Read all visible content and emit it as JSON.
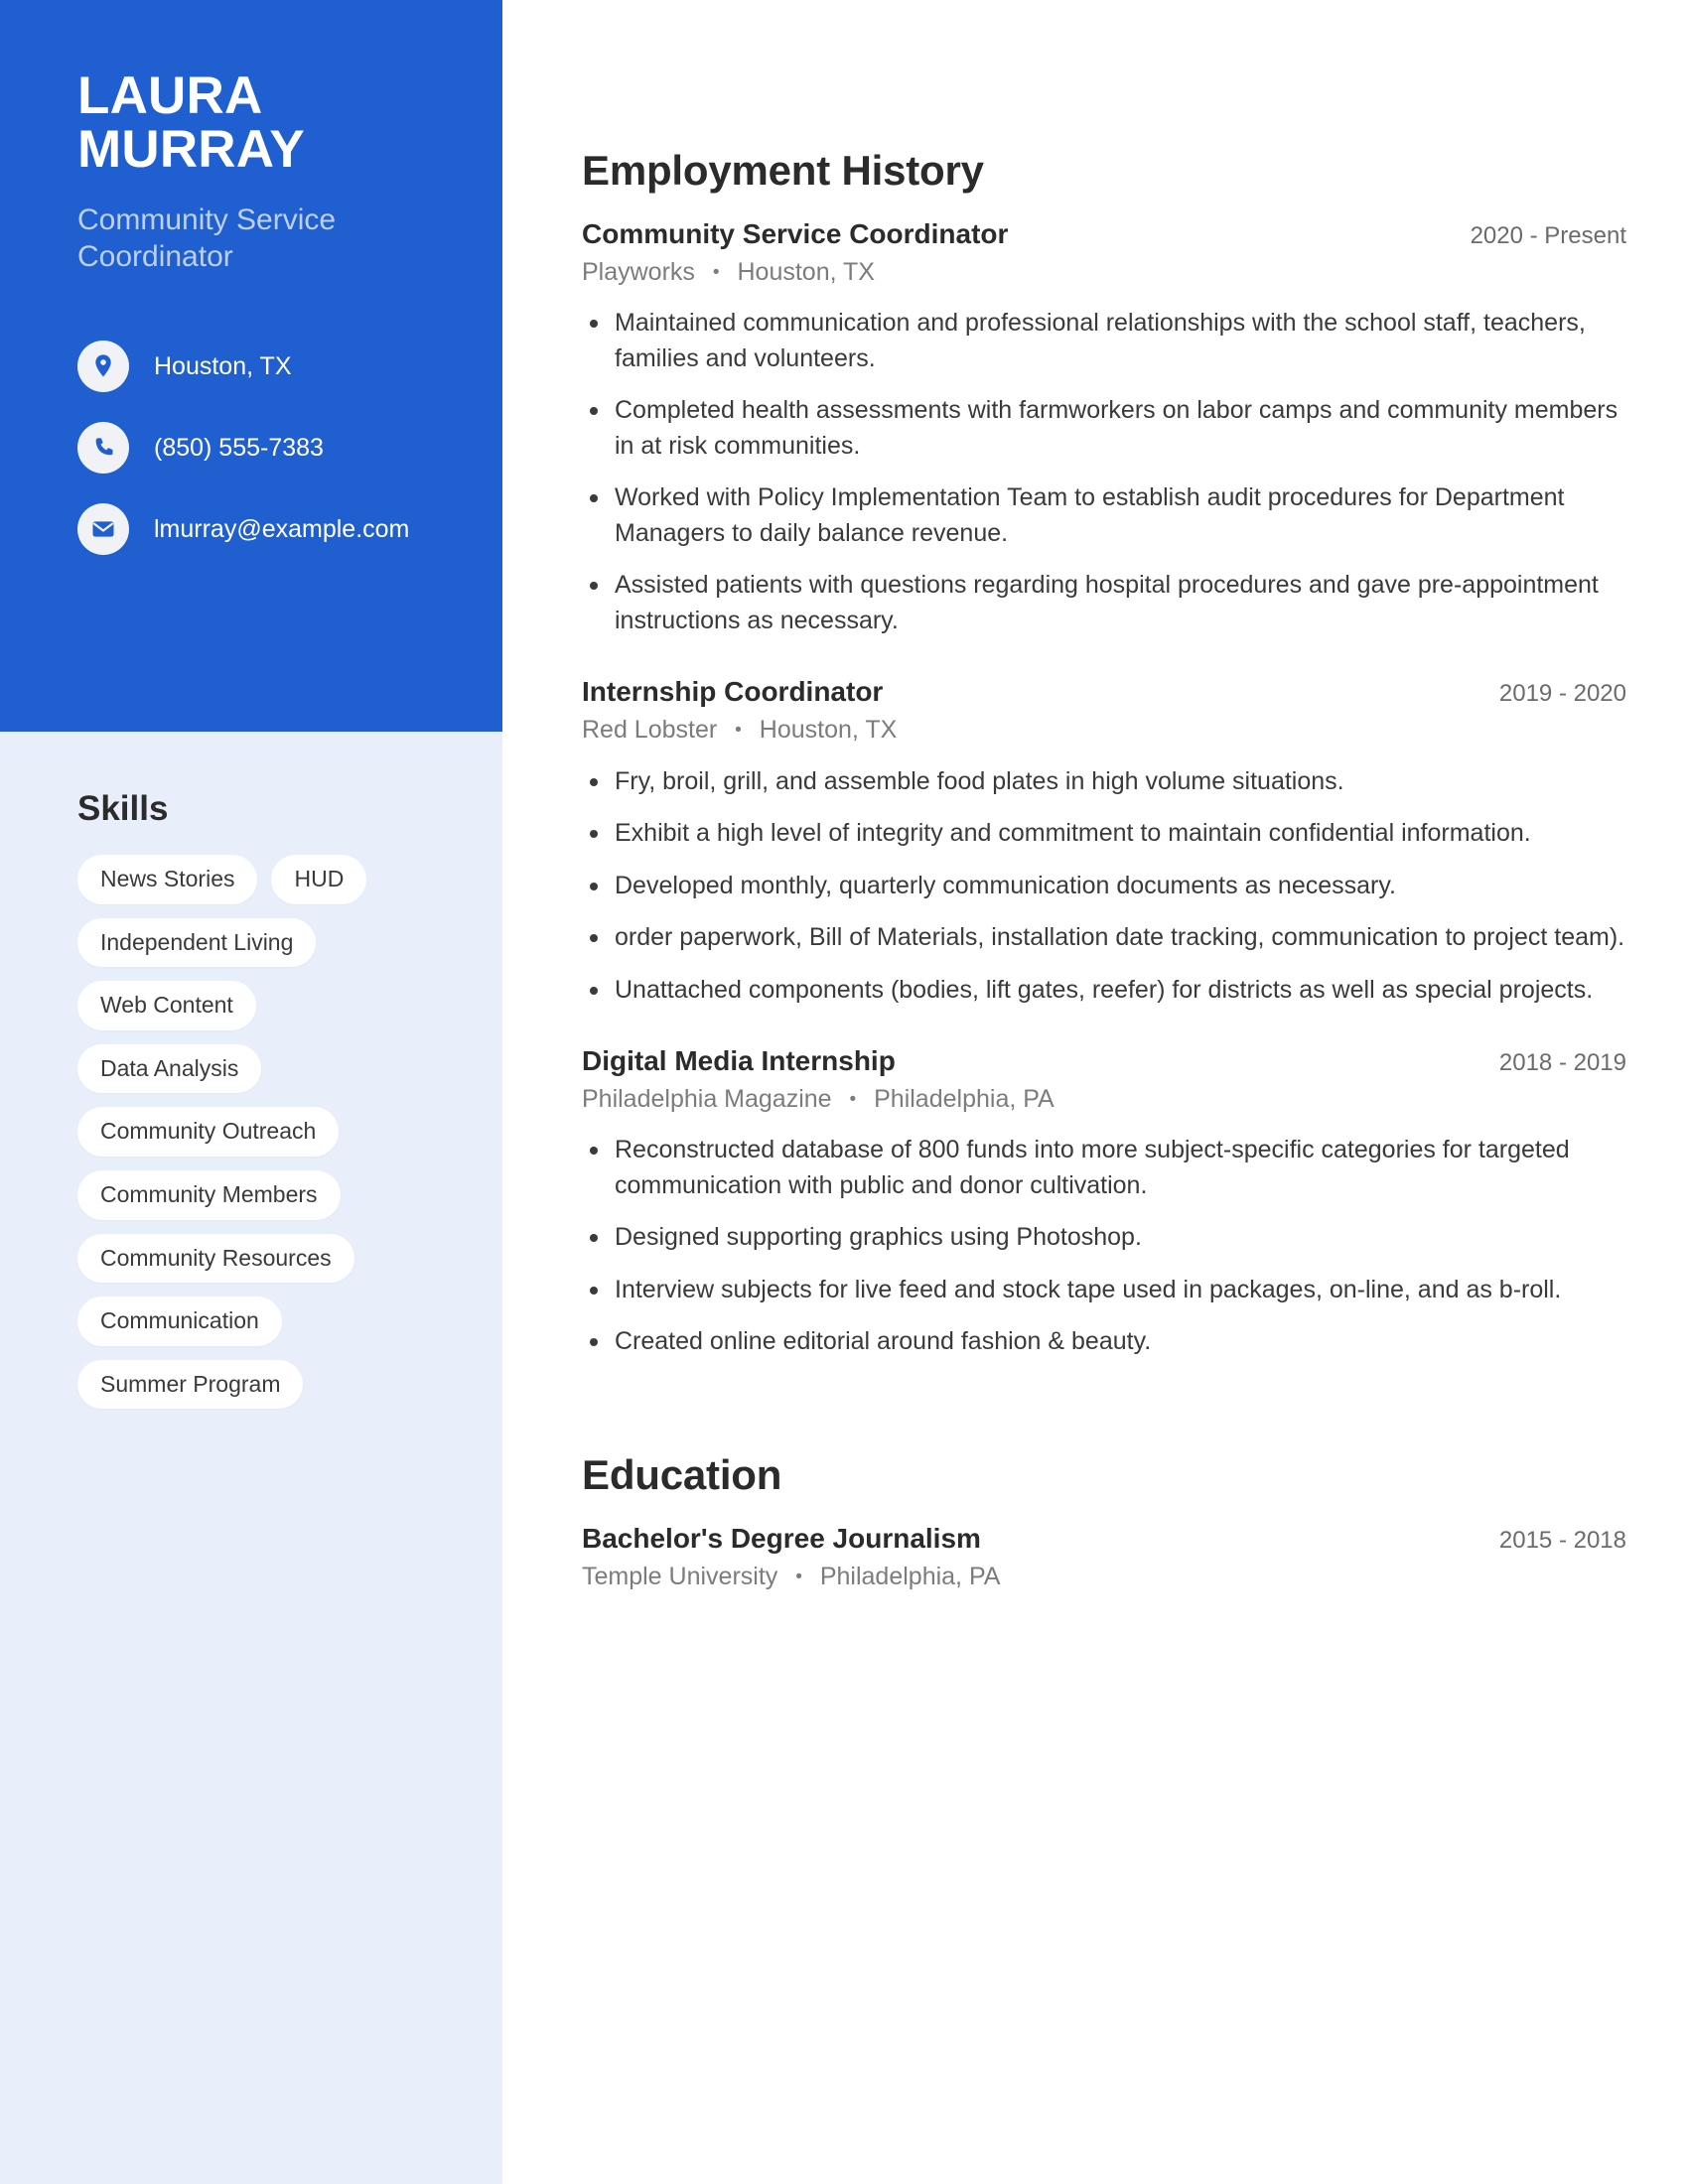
{
  "theme": {
    "accent_blue": "#1f5fd0",
    "sidebar_light": "#e8eefa",
    "subtitle_blue": "#bdd0ef",
    "pill_white": "#ffffff",
    "heading_dark": "#2b2b2b",
    "body_gray": "#3a3a3a",
    "meta_gray": "#7c7c7c"
  },
  "sidebar": {
    "name_first": "LAURA",
    "name_last": "MURRAY",
    "job_title": "Community Service Coordinator",
    "contacts": [
      {
        "icon": "location-pin-icon",
        "text": "Houston, TX"
      },
      {
        "icon": "phone-icon",
        "text": "(850) 555-7383"
      },
      {
        "icon": "envelope-icon",
        "text": "lmurray@example.com"
      }
    ],
    "skills_heading": "Skills",
    "skills": [
      "News Stories",
      "HUD",
      "Independent Living",
      "Web Content",
      "Data Analysis",
      "Community Outreach",
      "Community Members",
      "Community Resources",
      "Communication",
      "Summer Program"
    ]
  },
  "main": {
    "employment_heading": "Employment History",
    "education_heading": "Education",
    "separator": "•",
    "jobs": [
      {
        "role": "Community Service Coordinator",
        "dates": "2020 - Present",
        "company": "Playworks",
        "location": "Houston, TX",
        "bullets": [
          "Maintained communication and professional relationships with the school staff, teachers, families and volunteers.",
          "Completed health assessments with farmworkers on labor camps and community members in at risk communities.",
          "Worked with Policy Implementation Team to establish audit procedures for Department Managers to daily balance revenue.",
          "Assisted patients with questions regarding hospital procedures and gave pre-appointment instructions as necessary."
        ]
      },
      {
        "role": "Internship Coordinator",
        "dates": "2019 - 2020",
        "company": "Red Lobster",
        "location": "Houston, TX",
        "bullets": [
          "Fry, broil, grill, and assemble food plates in high volume situations.",
          "Exhibit a high level of integrity and commitment to maintain confidential information.",
          "Developed monthly, quarterly communication documents as necessary.",
          "order paperwork, Bill of Materials, installation date tracking, communication to project team).",
          "Unattached components (bodies, lift gates, reefer) for districts as well as special projects."
        ]
      },
      {
        "role": "Digital Media Internship",
        "dates": "2018 - 2019",
        "company": "Philadelphia Magazine",
        "location": "Philadelphia, PA",
        "bullets": [
          "Reconstructed database of 800 funds into more subject-specific categories for targeted communication with public and donor cultivation.",
          "Designed supporting graphics using Photoshop.",
          "Interview subjects for live feed and stock tape used in packages, on-line, and as b-roll.",
          "Created online editorial around fashion & beauty."
        ]
      }
    ],
    "education": [
      {
        "degree": "Bachelor's Degree Journalism",
        "dates": "2015 - 2018",
        "school": "Temple University",
        "location": "Philadelphia, PA"
      }
    ]
  }
}
